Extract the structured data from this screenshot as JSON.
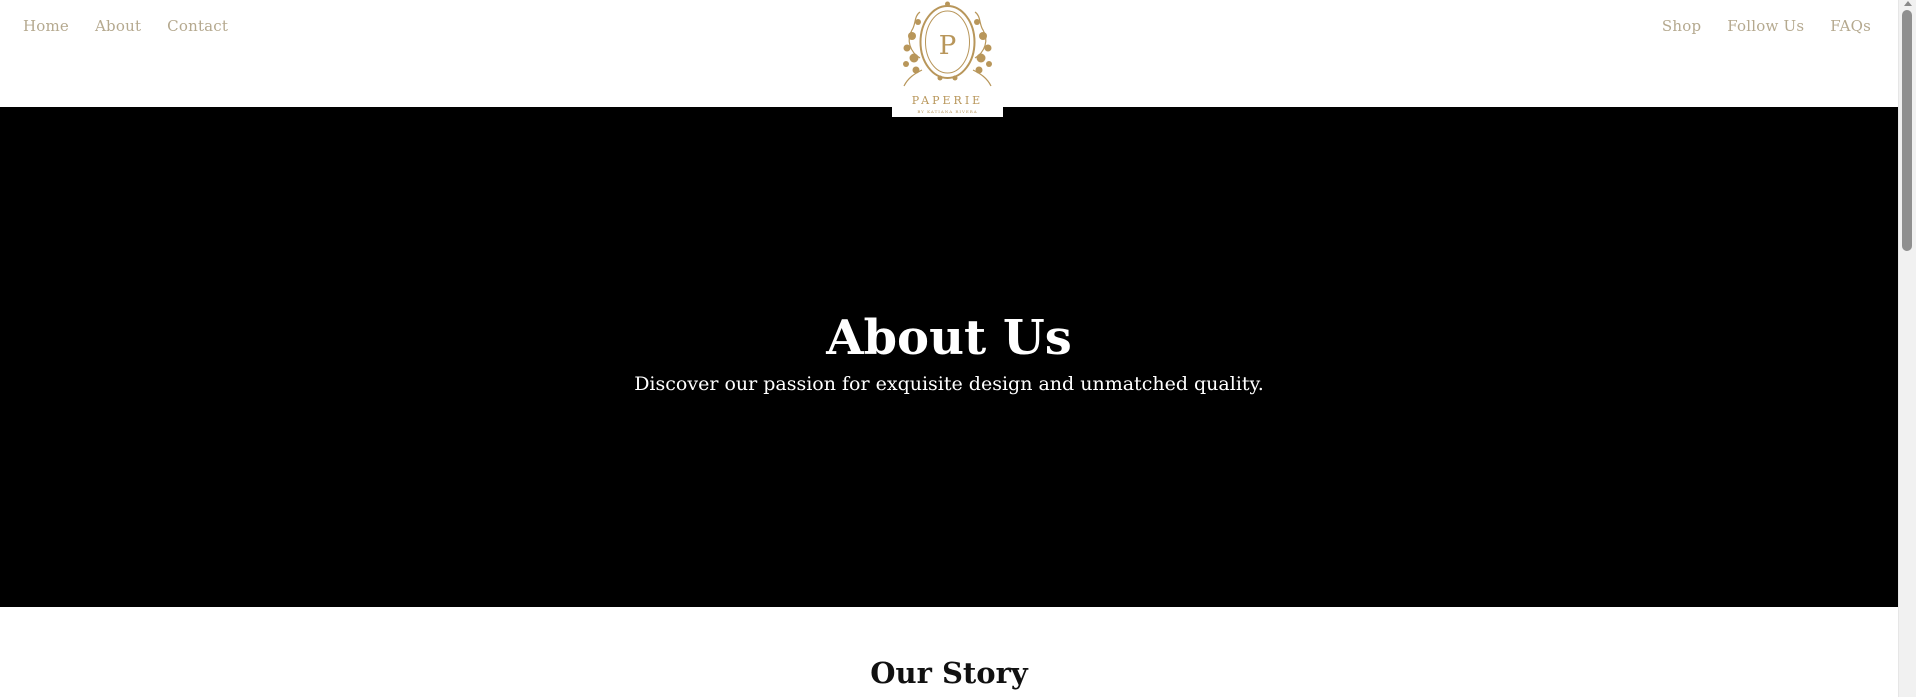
{
  "nav": {
    "left": [
      {
        "label": "Home"
      },
      {
        "label": "About"
      },
      {
        "label": "Contact"
      }
    ],
    "right": [
      {
        "label": "Shop"
      },
      {
        "label": "Follow Us"
      },
      {
        "label": "FAQs"
      }
    ]
  },
  "logo": {
    "monogram": "P",
    "wordmark": "PAPERIE",
    "tagline": "BY KATIANA RIVERA",
    "color": "#b8965a"
  },
  "hero": {
    "title": "About Us",
    "subtitle": "Discover our passion for exquisite design and unmatched quality."
  },
  "story": {
    "title": "Our Story"
  },
  "colors": {
    "nav_text": "#b5a98f",
    "hero_bg": "#000000",
    "hero_text": "#ffffff"
  }
}
